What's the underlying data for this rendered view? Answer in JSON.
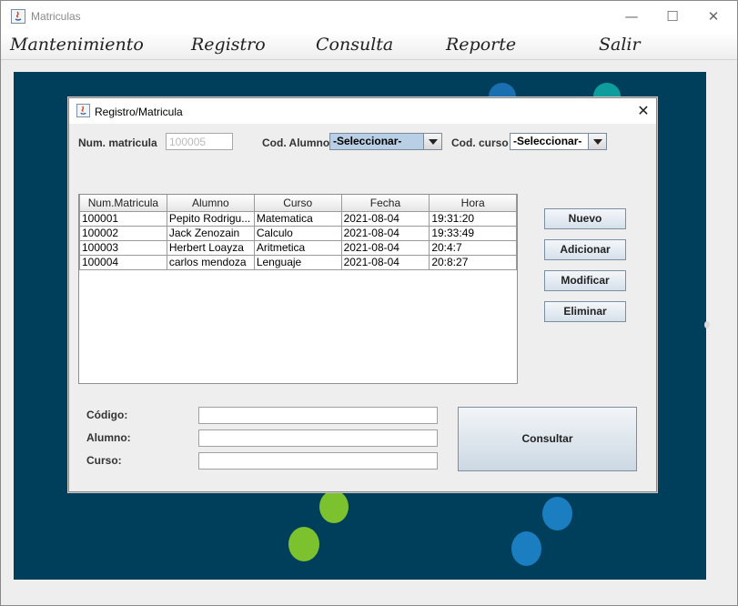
{
  "window": {
    "title": "Matriculas",
    "minimize": "—",
    "maximize": "☐",
    "close": "✕"
  },
  "menu": {
    "items": [
      "Mantenimiento",
      "Registro",
      "Consulta",
      "Reporte",
      "Salir"
    ]
  },
  "colors": {
    "desktop": "#003f5c",
    "bubble_green": "#7cc22e",
    "bubble_blue": "#1a7ec0",
    "bubble_teal": "#0f9c9c"
  },
  "dialog": {
    "title": "Registro/Matricula",
    "close": "✕",
    "num_matricula_label": "Num. matricula",
    "num_matricula_value": "100005",
    "cod_alumno_label": "Cod. Alumno",
    "cod_alumno_selected": "-Seleccionar-",
    "cod_curso_label": "Cod. curso",
    "cod_curso_selected": "-Seleccionar-",
    "table": {
      "columns": [
        "Num.Matricula",
        "Alumno",
        "Curso",
        "Fecha",
        "Hora"
      ],
      "rows": [
        [
          "100001",
          "Pepito Rodrigu...",
          "Matematica",
          "2021-08-04",
          "19:31:20"
        ],
        [
          "100002",
          "Jack Zenozain",
          "Calculo",
          "2021-08-04",
          "19:33:49"
        ],
        [
          "100003",
          "Herbert Loayza",
          "Aritmetica",
          "2021-08-04",
          "20:4:7"
        ],
        [
          "100004",
          "carlos mendoza",
          "Lenguaje",
          "2021-08-04",
          "20:8:27"
        ]
      ]
    },
    "buttons": {
      "nuevo": "Nuevo",
      "adicionar": "Adicionar",
      "modificar": "Modificar",
      "eliminar": "Eliminar",
      "consultar": "Consultar"
    },
    "query": {
      "codigo_label": "Código:",
      "alumno_label": "Alumno:",
      "curso_label": "Curso:",
      "codigo_value": "",
      "alumno_value": "",
      "curso_value": ""
    }
  }
}
